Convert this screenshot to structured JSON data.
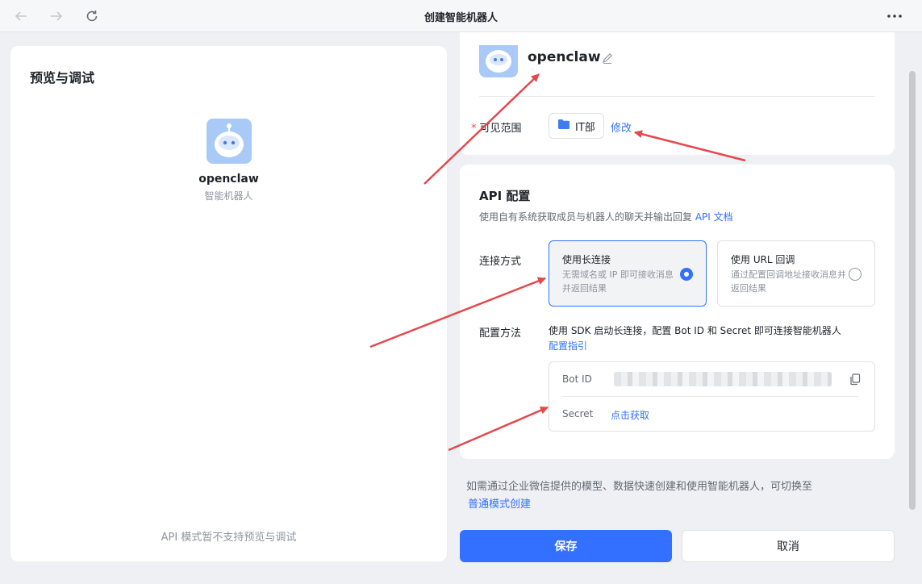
{
  "window": {
    "title": "创建智能机器人"
  },
  "left": {
    "title": "预览与调试",
    "bot_name": "openclaw",
    "bot_type": "智能机器人",
    "note": "API 模式暂不支持预览与调试"
  },
  "profile": {
    "name": "openclaw",
    "scope_label": "可见范围",
    "scope_value": "IT部",
    "modify": "修改"
  },
  "api": {
    "title": "API 配置",
    "desc": "使用自有系统获取成员与机器人的聊天并输出回复",
    "doc_link": "API 文档",
    "conn_label": "连接方式",
    "options": [
      {
        "title": "使用长连接",
        "desc": "无需域名或 IP 即可接收消息并返回结果",
        "selected": true
      },
      {
        "title": "使用 URL 回调",
        "desc": "通过配置回调地址接收消息并返回结果",
        "selected": false
      }
    ],
    "method_label": "配置方法",
    "method_desc": "使用 SDK 启动长连接，配置 Bot ID 和 Secret 即可连接智能机器人",
    "method_link": "配置指引",
    "bot_id_label": "Bot ID",
    "secret_label": "Secret",
    "secret_link": "点击获取"
  },
  "footer": {
    "switch_note": "如需通过企业微信提供的模型、数据快速创建和使用智能机器人，可切换至",
    "switch_link": "普通模式创建",
    "save": "保存",
    "cancel": "取消"
  },
  "colors": {
    "accent": "#3370ff",
    "annotation": "#e5484d"
  }
}
